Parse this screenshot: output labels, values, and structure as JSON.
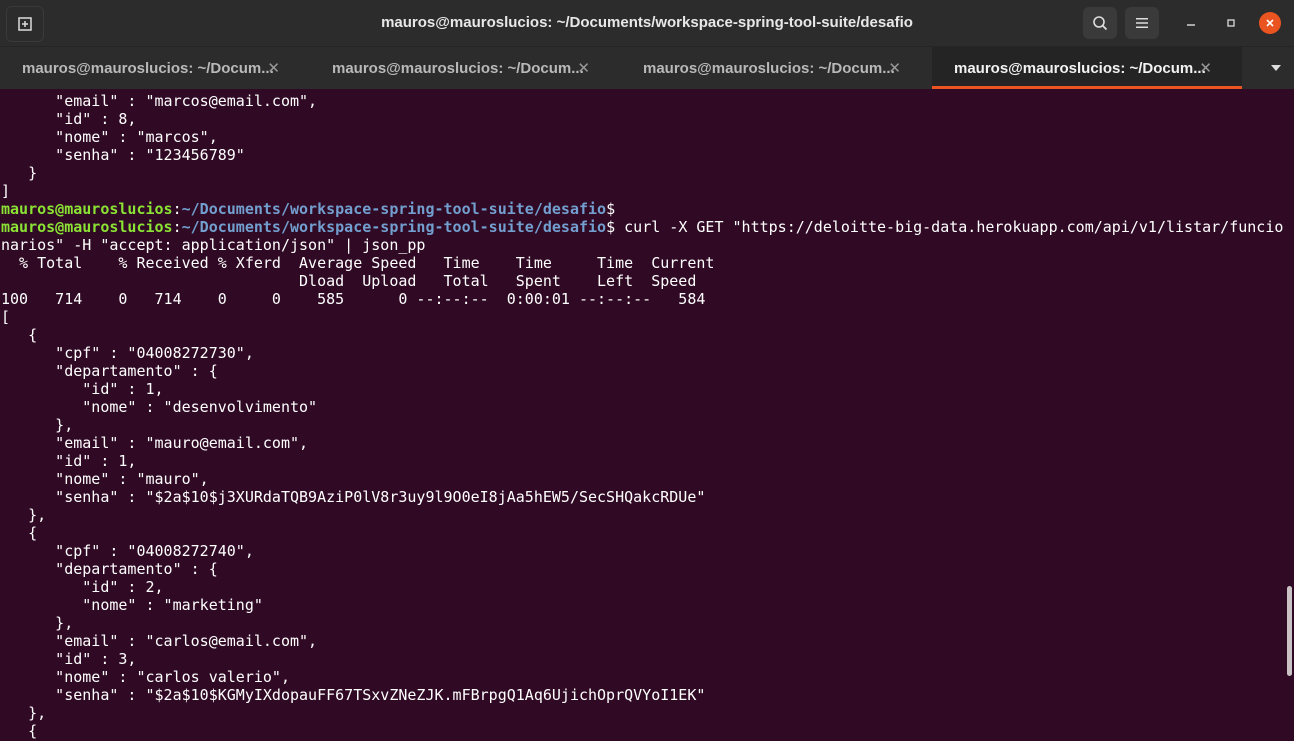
{
  "window": {
    "title": "mauros@mauroslucios: ~/Documents/workspace-spring-tool-suite/desafio",
    "icons": {
      "new_tab": "new-tab-icon",
      "search": "search-icon",
      "menu": "hamburger-menu-icon",
      "minimize": "minimize-icon",
      "maximize": "maximize-icon",
      "close": "close-icon"
    }
  },
  "tabs": [
    {
      "label": "mauros@mauroslucios: ~/Docum...",
      "active": false
    },
    {
      "label": "mauros@mauroslucios: ~/Docum...",
      "active": false
    },
    {
      "label": "mauros@mauroslucios: ~/Docum...",
      "active": false
    },
    {
      "label": "mauros@mauroslucios: ~/Docum...",
      "active": true
    }
  ],
  "colors": {
    "background": "#300a24",
    "prompt_user": "#8ae234",
    "prompt_path": "#729fcf",
    "accent": "#e95420"
  },
  "terminal": {
    "prompt_user": "mauros@mauroslucios",
    "prompt_sep": ":",
    "prompt_path": "~/Documents/workspace-spring-tool-suite/desafio",
    "prompt_end": "$",
    "command": " curl -X GET \"https://deloitte-big-data.herokuapp.com/api/v1/listar/funcio",
    "lines": [
      "      \"email\" : \"marcos@email.com\",",
      "      \"id\" : 8,",
      "      \"nome\" : \"marcos\",",
      "      \"senha\" : \"123456789\"",
      "   }",
      "]",
      "",
      "",
      "narios\" -H \"accept: application/json\" | json_pp",
      "  % Total    % Received % Xferd  Average Speed   Time    Time     Time  Current",
      "                                 Dload  Upload   Total   Spent    Left  Speed",
      "100   714    0   714    0     0    585      0 --:--:--  0:00:01 --:--:--   584",
      "[",
      "   {",
      "      \"cpf\" : \"04008272730\",",
      "      \"departamento\" : {",
      "         \"id\" : 1,",
      "         \"nome\" : \"desenvolvimento\"",
      "      },",
      "      \"email\" : \"mauro@email.com\",",
      "      \"id\" : 1,",
      "      \"nome\" : \"mauro\",",
      "      \"senha\" : \"$2a$10$j3XURdaTQB9AziP0lV8r3uy9l9O0eI8jAa5hEW5/SecSHQakcRDUe\"",
      "   },",
      "   {",
      "      \"cpf\" : \"04008272740\",",
      "      \"departamento\" : {",
      "         \"id\" : 2,",
      "         \"nome\" : \"marketing\"",
      "      },",
      "      \"email\" : \"carlos@email.com\",",
      "      \"id\" : 3,",
      "      \"nome\" : \"carlos valerio\",",
      "      \"senha\" : \"$2a$10$KGMyIXdopauFF67TSxvZNeZJK.mFBrpgQ1Aq6UjichOprQVYoI1EK\"",
      "   },",
      "   {"
    ]
  }
}
